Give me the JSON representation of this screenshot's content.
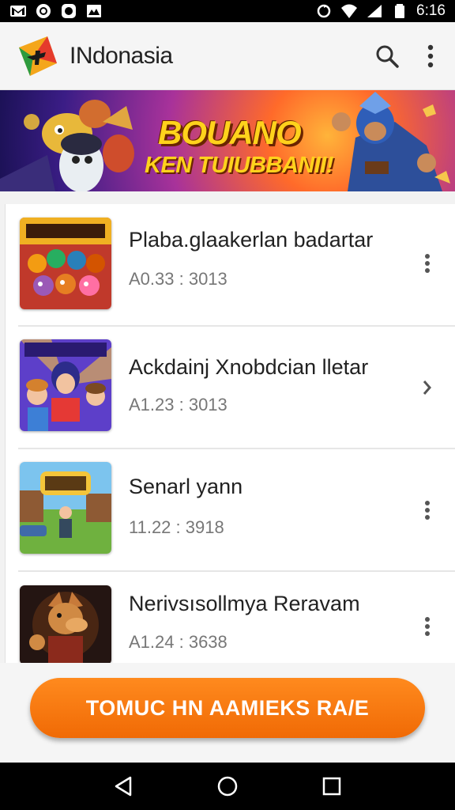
{
  "status_bar": {
    "time": "6:16",
    "left_icons": [
      "gmail-icon",
      "chrome-icon",
      "messenger-icon",
      "photo-icon"
    ],
    "right_icons": [
      "sync-icon",
      "wifi-icon",
      "signal-icon",
      "battery-icon"
    ]
  },
  "app_bar": {
    "title": "INdonasia",
    "logo": "app-logo-icon",
    "actions": [
      "search-icon",
      "more-vert-icon"
    ]
  },
  "banner": {
    "title": "BOUANO",
    "subtitle": "KEN TUIUBBANII!"
  },
  "list": {
    "items": [
      {
        "title": "Plaba.glaakerlan badartar",
        "meta": "A0.33 : 3013",
        "thumb": "game-thumb-monsters"
      },
      {
        "title": "Ackdainj Xnobdcian lletar",
        "meta": "A1.23 : 3013",
        "thumb": "game-thumb-heroes"
      },
      {
        "title": "Senarl yann",
        "meta": "11.22 : 3918",
        "thumb": "game-thumb-village"
      },
      {
        "title": "Nerivsısollmya Reravam",
        "meta": "A1.24 : 3638",
        "thumb": "game-thumb-warrior"
      }
    ]
  },
  "cta": {
    "label": "TOMUC HN AAMIEKS RA/E"
  },
  "nav_bar": {
    "buttons": [
      "back-icon",
      "home-icon",
      "recents-icon"
    ]
  },
  "colors": {
    "accent": "#f57c0b",
    "status_bar": "#000000",
    "banner_gold": "#ffd21c"
  }
}
